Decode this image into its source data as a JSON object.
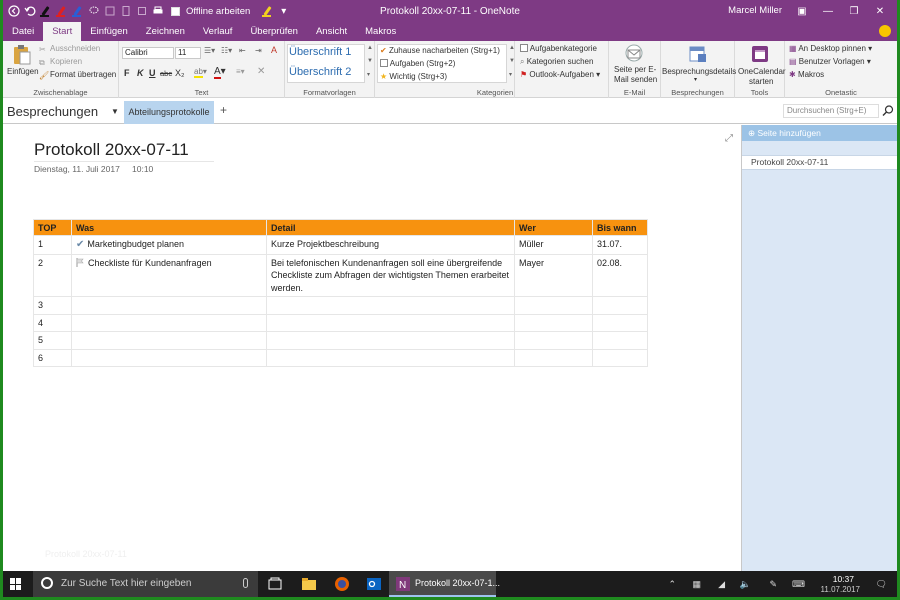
{
  "window": {
    "title": "Protokoll 20xx-07-11  -  OneNote",
    "user": "Marcel Miller",
    "offline_label": "Offline arbeiten"
  },
  "ribbon_tabs": [
    "Datei",
    "Start",
    "Einfügen",
    "Zeichnen",
    "Verlauf",
    "Überprüfen",
    "Ansicht",
    "Makros"
  ],
  "ribbon": {
    "clipboard": {
      "paste": "Einfügen",
      "cut": "Ausschneiden",
      "copy": "Kopieren",
      "format_painter": "Format übertragen",
      "group": "Zwischenablage"
    },
    "text": {
      "font": "Calibri",
      "size": "11",
      "bold": "F",
      "italic": "K",
      "underline": "U",
      "strike": "abc",
      "subscript": "X₂",
      "group": "Text"
    },
    "styles": {
      "heading1": "Überschrift 1",
      "heading2": "Überschrift 2",
      "group": "Formatvorlagen"
    },
    "tags": {
      "items": [
        "Zuhause nacharbeiten (Strg+1)",
        "Aufgaben (Strg+2)",
        "Wichtig (Strg+3)"
      ],
      "group": "Kategorien"
    },
    "categories": {
      "task_category": "Aufgabenkategorie",
      "find_tags": "Kategorien suchen",
      "outlook_tasks": "Outlook-Aufgaben"
    },
    "email": {
      "label1": "Seite per E-",
      "label2": "Mail senden",
      "group": "E-Mail"
    },
    "meetings": {
      "label": "Besprechungsdetails",
      "group": "Besprechungen"
    },
    "tools": {
      "label1": "OneCalendar",
      "label2": "starten",
      "group": "Tools"
    },
    "onetastic": {
      "pin": "An Desktop pinnen",
      "user_templates": "Benutzer Vorlagen",
      "macros": "Makros",
      "group": "Onetastic"
    }
  },
  "notebook": {
    "name": "Besprechungen",
    "section_tab": "Abteilungsprotokolle",
    "add_tab": "+",
    "search_placeholder": "Durchsuchen (Strg+E)"
  },
  "page": {
    "title": "Protokoll 20xx-07-11",
    "date": "Dienstag, 11. Juli 2017",
    "time": "10:10",
    "faded_text": "Protokoll 20xx-07-11"
  },
  "table": {
    "headers": [
      "TOP",
      "Was",
      "Detail",
      "Wer",
      "Bis wann"
    ],
    "rows": [
      {
        "top": "1",
        "was": "Marketingbudget planen",
        "tag": "check",
        "detail": "Kurze Projektbeschreibung",
        "wer": "Müller",
        "bis": "31.07."
      },
      {
        "top": "2",
        "was": "Checkliste für Kundenanfragen",
        "tag": "flag",
        "detail": "Bei telefonischen Kundenanfragen soll eine übergreifende Checkliste zum Abfragen der wichtigsten Themen erarbeitet werden.",
        "wer": "Mayer",
        "bis": "02.08."
      },
      {
        "top": "3",
        "was": "",
        "tag": "",
        "detail": "",
        "wer": "",
        "bis": ""
      },
      {
        "top": "4",
        "was": "",
        "tag": "",
        "detail": "",
        "wer": "",
        "bis": ""
      },
      {
        "top": "5",
        "was": "",
        "tag": "",
        "detail": "",
        "wer": "",
        "bis": ""
      },
      {
        "top": "6",
        "was": "",
        "tag": "",
        "detail": "",
        "wer": "",
        "bis": ""
      }
    ]
  },
  "page_pane": {
    "add_page": "Seite hinzufügen",
    "pages": [
      "Protokoll 20xx-07-11"
    ]
  },
  "taskbar": {
    "search_placeholder": "Zur Suche Text hier eingeben",
    "active_app": "Protokoll 20xx-07-1...",
    "time": "10:37",
    "date": "11.07.2017"
  },
  "colors": {
    "onenote_purple": "#7e3a84",
    "table_header": "#f7920f",
    "section_tab": "#b8d4ee",
    "page_pane": "#dbe7f5"
  }
}
